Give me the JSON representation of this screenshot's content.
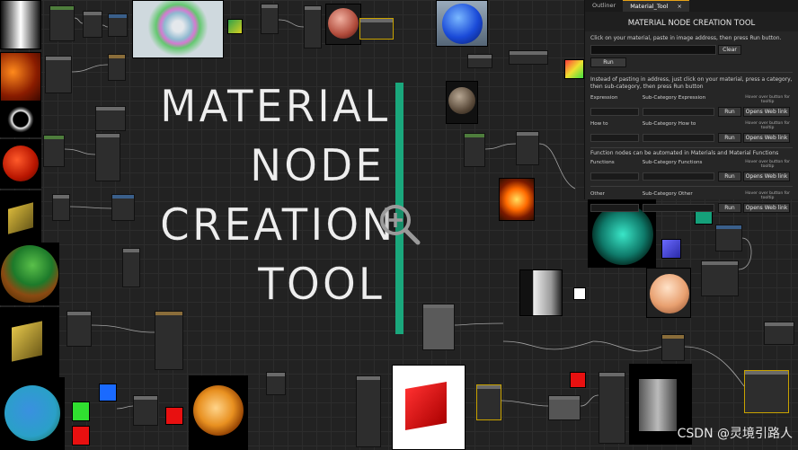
{
  "title_lines": [
    "MATERIAL",
    "NODE",
    "CREATION",
    "TOOL"
  ],
  "accent_color": "#1aa77c",
  "zoom_icon": "zoom-in-icon",
  "panel": {
    "tabs": [
      {
        "label": "Outliner"
      },
      {
        "label": "Material_Tool"
      }
    ],
    "close_glyph": "×",
    "title": "MATERIAL NODE CREATION TOOL",
    "instruction1": "Click on your material, paste in image address, then press Run button.",
    "clear_label": "Clear",
    "run_label": "Run",
    "instruction2": "Instead of pasting in address, just click on your material, press a category, then sub-category, then press Run button",
    "sections": [
      {
        "left": "Expression",
        "mid": "Sub-Category Expression",
        "hint": "Hover over button for tooltip",
        "run": "Run",
        "web": "Opens Web link"
      },
      {
        "left": "How to",
        "mid": "Sub-Category How to",
        "hint": "Hover over button for tooltip",
        "run": "Run",
        "web": "Opens Web link"
      }
    ],
    "functions_note": "Function nodes can be automated in Materials and Material Functions",
    "sections2": [
      {
        "left": "Functions",
        "mid": "Sub-Category Functions",
        "hint": "Hover over button for tooltip",
        "run": "Run",
        "web": "Opens Web link"
      },
      {
        "left": "Other",
        "mid": "Sub-Category Other",
        "hint": "Hover over button for tooltip",
        "run": "Run",
        "web": "Opens Web link"
      }
    ]
  },
  "watermark": "CSDN @灵境引路人"
}
